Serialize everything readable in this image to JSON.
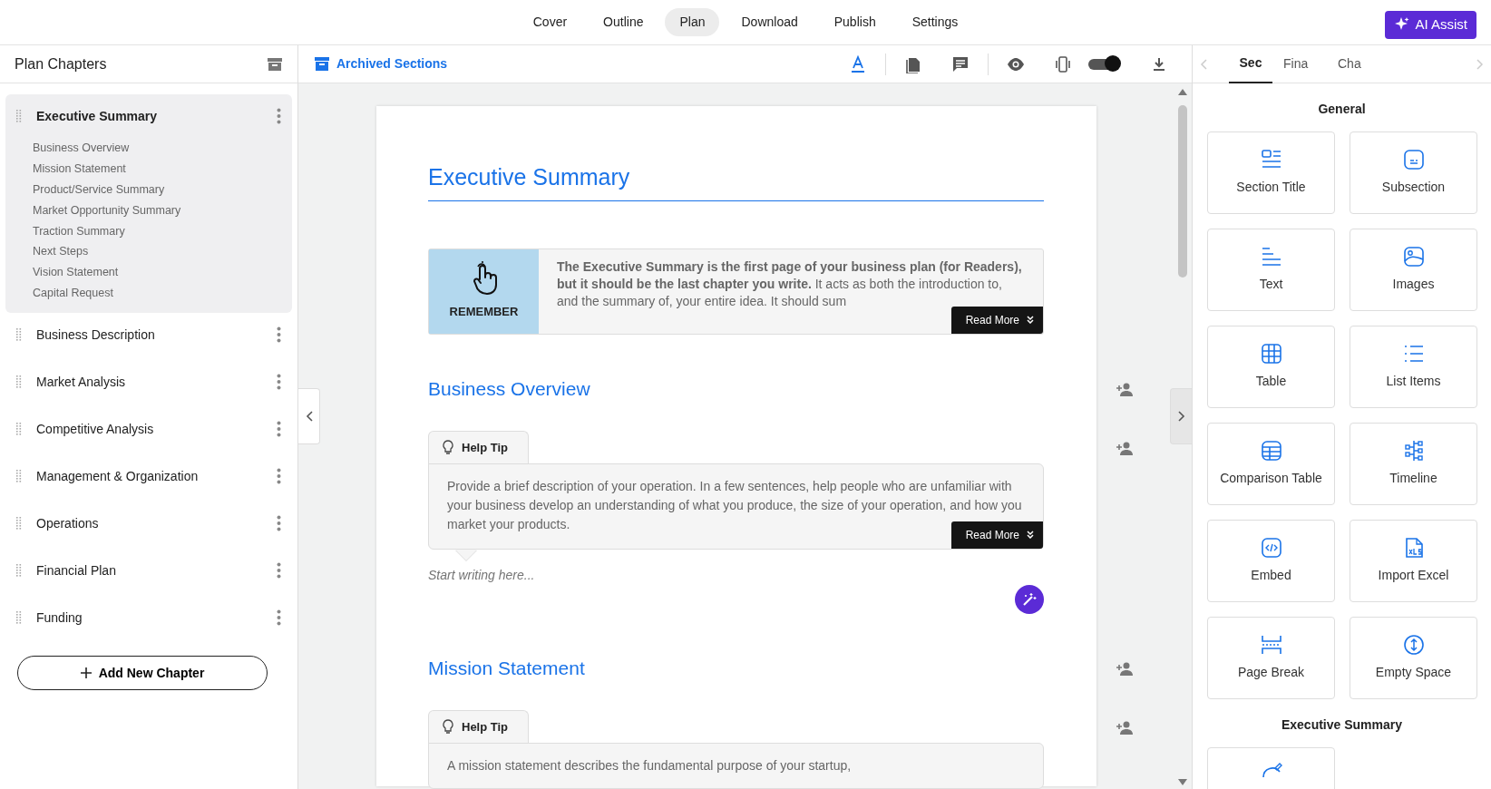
{
  "top_nav": {
    "tabs": [
      {
        "label": "Cover",
        "selected": false
      },
      {
        "label": "Outline",
        "selected": false
      },
      {
        "label": "Plan",
        "selected": true
      },
      {
        "label": "Download",
        "selected": false
      },
      {
        "label": "Publish",
        "selected": false
      },
      {
        "label": "Settings",
        "selected": false
      }
    ],
    "ai_button": "AI Assist"
  },
  "sidebar": {
    "title": "Plan Chapters",
    "chapters": [
      {
        "label": "Executive Summary",
        "selected": true,
        "children": [
          {
            "label": "Business Overview"
          },
          {
            "label": "Mission Statement"
          },
          {
            "label": "Product/Service Summary"
          },
          {
            "label": "Market Opportunity Summary"
          },
          {
            "label": "Traction Summary"
          },
          {
            "label": "Next Steps"
          },
          {
            "label": "Vision Statement"
          },
          {
            "label": "Capital Request"
          }
        ]
      },
      {
        "label": "Business Description",
        "selected": false
      },
      {
        "label": "Market Analysis",
        "selected": false
      },
      {
        "label": "Competitive Analysis",
        "selected": false
      },
      {
        "label": "Management & Organization",
        "selected": false
      },
      {
        "label": "Operations",
        "selected": false
      },
      {
        "label": "Financial Plan",
        "selected": false
      },
      {
        "label": "Funding",
        "selected": false
      }
    ],
    "add_button": "Add New Chapter"
  },
  "toolbar": {
    "archived_link": "Archived Sections",
    "toggle": {
      "on": true
    }
  },
  "document": {
    "title": "Executive Summary",
    "callout": {
      "badge": "REMEMBER",
      "text": "**The Executive Summary is the first page of your business plan (for Readers), but it should be the last chapter you write.** It acts as both the introduction to, and the summary of, your entire idea. It should sum",
      "button": "Read More"
    },
    "sections": [
      {
        "heading": "Business Overview",
        "tip": {
          "tab": "Help Tip",
          "text": "Provide a brief description of your operation. In a few sentences, help people who are unfamiliar with your business develop an understanding of what you produce, the size of your operation, and how you market your products.",
          "button": "Read More"
        },
        "placeholder": "Start writing here..."
      },
      {
        "heading": "Mission Statement",
        "tip": {
          "tab": "Help Tip",
          "text": "A mission statement describes the fundamental purpose of your startup,"
        }
      }
    ]
  },
  "right_panel": {
    "tabs": [
      {
        "label": "Sec",
        "selected": true
      },
      {
        "label": "Fina",
        "selected": false
      },
      {
        "label": "Cha",
        "selected": false
      }
    ],
    "groups": [
      {
        "title": "General",
        "items": [
          {
            "kind": "section-title",
            "label": "Section Title"
          },
          {
            "kind": "subsection",
            "label": "Subsection"
          },
          {
            "kind": "text",
            "label": "Text"
          },
          {
            "kind": "images",
            "label": "Images"
          },
          {
            "kind": "table",
            "label": "Table"
          },
          {
            "kind": "list",
            "label": "List Items"
          },
          {
            "kind": "comparison",
            "label": "Comparison Table"
          },
          {
            "kind": "timeline",
            "label": "Timeline"
          },
          {
            "kind": "embed",
            "label": "Embed"
          },
          {
            "kind": "excel",
            "label": "Import Excel"
          },
          {
            "kind": "page-break",
            "label": "Page Break"
          },
          {
            "kind": "space",
            "label": "Empty Space"
          }
        ]
      },
      {
        "title": "Executive Summary",
        "items": [
          {
            "kind": "chart"
          }
        ]
      }
    ]
  }
}
